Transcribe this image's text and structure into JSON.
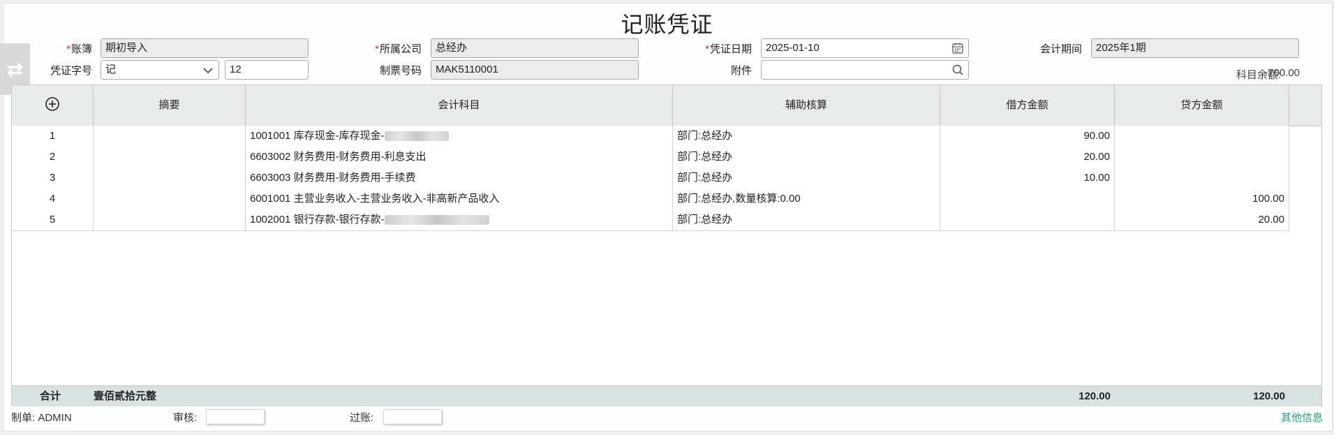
{
  "title": "记账凭证",
  "form": {
    "ledger_label": "账簿",
    "ledger_value": "期初导入",
    "company_label": "所属公司",
    "company_value": "总经办",
    "date_label": "凭证日期",
    "date_value": "2025-01-10",
    "period_label": "会计期间",
    "period_value": "2025年1期",
    "word_label": "凭证字号",
    "word_value": "记",
    "number_value": "12",
    "ticket_label": "制票号码",
    "ticket_value": "MAK5110001",
    "attach_label": "附件",
    "attach_value": ""
  },
  "balance": {
    "label": "科目余额:",
    "value": "-700.00"
  },
  "table": {
    "headers": {
      "summary": "摘要",
      "account": "会计科目",
      "aux": "辅助核算",
      "debit": "借方金额",
      "credit": "贷方金额"
    },
    "rows": [
      {
        "no": "1",
        "summary": "",
        "account": "1001001 库存现金-库存现金-",
        "aux": "部门:总经办",
        "debit": "90.00",
        "credit": ""
      },
      {
        "no": "2",
        "summary": "",
        "account": "6603002 财务费用-财务费用-利息支出",
        "aux": "部门:总经办",
        "debit": "20.00",
        "credit": ""
      },
      {
        "no": "3",
        "summary": "",
        "account": "6603003 财务费用-财务费用-手续费",
        "aux": "部门:总经办",
        "debit": "10.00",
        "credit": ""
      },
      {
        "no": "4",
        "summary": "",
        "account": "6001001 主营业务收入-主营业务收入-非高新产品收入",
        "aux": "部门:总经办,数量核算:0.00",
        "debit": "",
        "credit": "100.00"
      },
      {
        "no": "5",
        "summary": "",
        "account": "1002001 银行存款-银行存款-",
        "aux": "部门:总经办",
        "debit": "",
        "credit": "20.00"
      }
    ],
    "total": {
      "label": "合计",
      "words": "壹佰贰拾元整",
      "debit": "120.00",
      "credit": "120.00"
    }
  },
  "footer": {
    "maker_label": "制单:",
    "maker_value": "ADMIN",
    "audit_label": "审核:",
    "post_label": "过账:",
    "other_info": "其他信息"
  },
  "icons": {
    "side_toggle": "swap-arrows-icon",
    "add": "plus-circle-icon",
    "calendar": "calendar-icon",
    "search": "search-icon",
    "dropdown": "chevron-down-icon"
  },
  "colors": {
    "required": "#e02020",
    "link": "#1aa67c",
    "header_bg": "#e9ebeb",
    "footer_bg": "#d9e2e2"
  }
}
